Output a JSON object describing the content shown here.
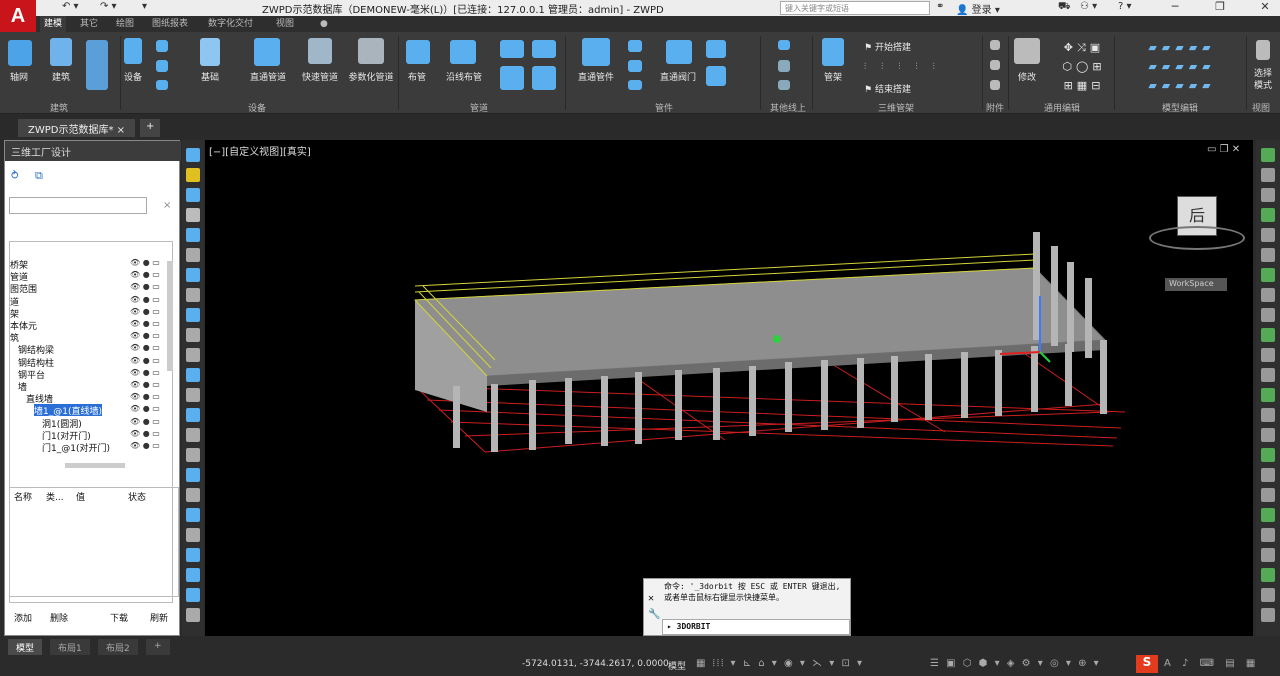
{
  "titlebar": {
    "title": "ZWPD示范数据库（DEMONEW-毫米(L)）[已连接：127.0.0.1 管理员：admin] - ZWPD",
    "search_placeholder": "键入关键字或短语",
    "login_label": "登录"
  },
  "logo": "A",
  "menu_tabs": [
    "建模",
    "其它",
    "绘图",
    "图纸报表",
    "数字化交付",
    "视图",
    "●"
  ],
  "ribbon": {
    "buttons": {
      "axis": "轴网",
      "building": "建筑",
      "equipment": "设备",
      "foundation": "基础",
      "straight_pipe": "直通管道",
      "quick_pipe": "快速管道",
      "param_pipe": "参数化管道",
      "layout_pipe": "布管",
      "along_pipe": "沿线布管",
      "straight_fitting": "直通管件",
      "straight_valve": "直通阀门",
      "pipe_rack": "管架",
      "start_build": "开始搭建",
      "end_build": "结束搭建",
      "modify": "修改",
      "select_mode": "选择\n模式"
    },
    "groups": [
      "建筑",
      "设备",
      "管道",
      "管件",
      "其他线上",
      "三维管架",
      "附件",
      "通用编辑",
      "模型编辑",
      "视图"
    ]
  },
  "doc_tab": "ZWPD示范数据库*",
  "left_panel": {
    "title": "三维工厂设计",
    "tree_items": [
      {
        "label": "桥架",
        "indent": 0
      },
      {
        "label": "管道",
        "indent": 0
      },
      {
        "label": "图范围",
        "indent": 0
      },
      {
        "label": "道",
        "indent": 0
      },
      {
        "label": "架",
        "indent": 0
      },
      {
        "label": "本体元",
        "indent": 0
      },
      {
        "label": "筑",
        "indent": 0
      },
      {
        "label": "钢结构梁",
        "indent": 1
      },
      {
        "label": "钢结构柱",
        "indent": 1
      },
      {
        "label": "钢平台",
        "indent": 1
      },
      {
        "label": "墙",
        "indent": 1
      },
      {
        "label": "直线墙",
        "indent": 2
      },
      {
        "label": "墙1_@1(直线墙)",
        "indent": 3,
        "selected": true
      },
      {
        "label": "洞1(圆洞)",
        "indent": 4
      },
      {
        "label": "门1(对开门)",
        "indent": 4
      },
      {
        "label": "门1_@1(对开门)",
        "indent": 4
      }
    ],
    "grid_headers": [
      "名称",
      "类...",
      "值",
      "状态"
    ],
    "buttons": [
      "添加",
      "删除",
      "下载",
      "刷新"
    ]
  },
  "viewport": {
    "label": "[−][自定义视图][真实]",
    "viewcube_face": "后",
    "workspace_label": "WorkSpace"
  },
  "command": {
    "history": "命令: '_3dorbit 按 ESC 或 ENTER 键退出, 或者单击鼠标右键显示快捷菜单。",
    "input": "3DORBIT"
  },
  "bottom_tabs": [
    "模型",
    "布局1",
    "布局2",
    "+"
  ],
  "status": {
    "coords": "-5724.0131, -3744.2617, 0.0000",
    "mode": "模型"
  }
}
